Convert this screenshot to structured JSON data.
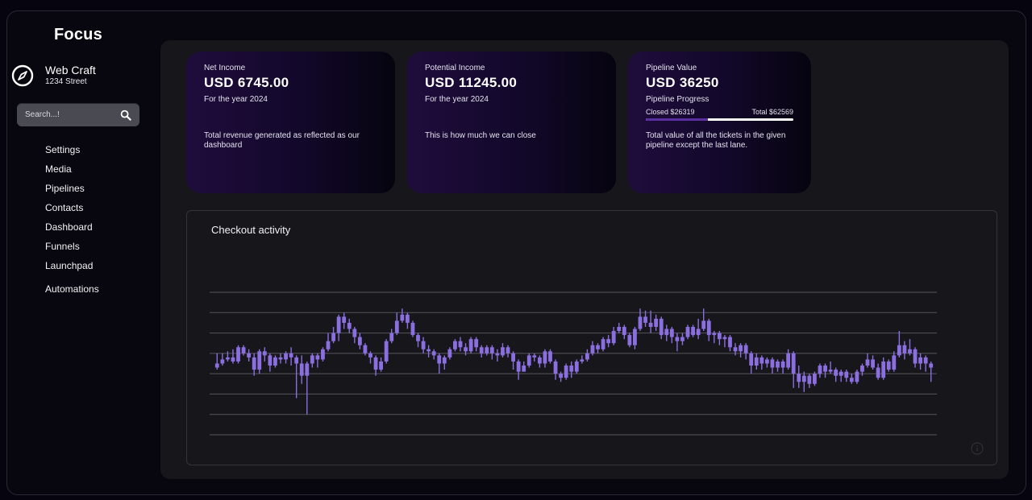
{
  "app": {
    "brand": "Focus"
  },
  "account": {
    "name": "Web Craft",
    "address": "1234 Street"
  },
  "search": {
    "placeholder": "Search...!"
  },
  "nav": {
    "items": [
      "Settings",
      "Media",
      "Pipelines",
      "Contacts",
      "Dashboard",
      "Funnels",
      "Launchpad",
      "Automations"
    ]
  },
  "cards": {
    "net_income": {
      "label": "Net Income",
      "value": "USD 6745.00",
      "sub": "For the year 2024",
      "desc": "Total revenue generated as reflected as our dashboard"
    },
    "potential_income": {
      "label": "Potential Income",
      "value": "USD 11245.00",
      "sub": "For the year 2024",
      "desc": "This is how much we can close"
    },
    "pipeline_value": {
      "label": "Pipeline Value",
      "value": "USD 36250",
      "sub": "Pipeline Progress",
      "closed_label": "Closed $26319",
      "total_label": "Total $62569",
      "progress": 0.42,
      "desc": "Total value of all the tickets in the given pipeline except the last lane."
    }
  },
  "colors": {
    "accent": "#8b6ee0",
    "progress_fill": "#5a2fa0",
    "card_start": "#1f0c3c",
    "card_end": "#06040f"
  },
  "icons": {
    "account": "compass-icon",
    "search": "search-icon",
    "chart_info": "info-icon"
  },
  "chart_data": {
    "type": "candlestick",
    "title": "Checkout activity",
    "ylim": [
      0,
      7
    ],
    "grid": true,
    "series": [
      {
        "values": [
          [
            3.5,
            3.3,
            4.0,
            3.2
          ],
          [
            3.5,
            3.7,
            4.0,
            3.4
          ],
          [
            3.7,
            3.8,
            4.1,
            3.6
          ],
          [
            3.8,
            3.6,
            4.2,
            3.5
          ],
          [
            3.6,
            4.3,
            4.4,
            3.5
          ],
          [
            4.3,
            4.0,
            4.4,
            3.9
          ],
          [
            4.0,
            3.8,
            4.2,
            3.6
          ],
          [
            3.8,
            3.2,
            4.0,
            2.9
          ],
          [
            3.2,
            4.1,
            4.2,
            3.0
          ],
          [
            4.1,
            3.9,
            4.3,
            3.6
          ],
          [
            3.9,
            3.4,
            4.0,
            3.1
          ],
          [
            3.4,
            3.8,
            3.9,
            3.3
          ],
          [
            3.8,
            3.7,
            4.0,
            3.5
          ],
          [
            3.7,
            4.0,
            4.1,
            3.5
          ],
          [
            4.0,
            3.8,
            4.3,
            3.4
          ],
          [
            3.8,
            3.5,
            3.9,
            1.8
          ],
          [
            3.5,
            2.9,
            3.9,
            2.5
          ],
          [
            2.9,
            3.5,
            3.6,
            1.0
          ],
          [
            3.5,
            3.9,
            4.0,
            3.3
          ],
          [
            3.9,
            3.7,
            4.0,
            3.3
          ],
          [
            3.7,
            4.2,
            4.3,
            3.6
          ],
          [
            4.2,
            4.6,
            5.0,
            4.1
          ],
          [
            4.6,
            5.0,
            5.3,
            4.5
          ],
          [
            5.0,
            5.8,
            5.9,
            4.6
          ],
          [
            5.8,
            5.5,
            6.0,
            5.2
          ],
          [
            5.5,
            5.2,
            5.7,
            5.0
          ],
          [
            5.2,
            4.8,
            5.3,
            4.5
          ],
          [
            4.8,
            4.4,
            5.0,
            4.2
          ],
          [
            4.4,
            4.0,
            4.5,
            3.9
          ],
          [
            4.0,
            3.8,
            4.1,
            3.5
          ],
          [
            3.8,
            3.2,
            3.9,
            2.9
          ],
          [
            3.2,
            3.6,
            3.8,
            3.1
          ],
          [
            3.6,
            4.6,
            4.7,
            3.5
          ],
          [
            4.6,
            5.0,
            5.2,
            4.5
          ],
          [
            5.0,
            5.6,
            6.0,
            4.9
          ],
          [
            5.6,
            5.9,
            6.2,
            5.5
          ],
          [
            5.9,
            5.5,
            6.0,
            5.2
          ],
          [
            5.5,
            4.9,
            5.6,
            4.8
          ],
          [
            4.9,
            4.6,
            5.0,
            4.3
          ],
          [
            4.6,
            4.2,
            4.8,
            4.0
          ],
          [
            4.2,
            4.1,
            4.4,
            3.8
          ],
          [
            4.1,
            3.9,
            4.2,
            3.7
          ],
          [
            3.9,
            3.5,
            4.0,
            3.0
          ],
          [
            3.5,
            3.8,
            3.9,
            3.2
          ],
          [
            3.8,
            4.2,
            4.3,
            3.7
          ],
          [
            4.2,
            4.6,
            4.7,
            4.1
          ],
          [
            4.6,
            4.3,
            4.8,
            4.1
          ],
          [
            4.3,
            4.1,
            4.5,
            3.9
          ],
          [
            4.1,
            4.7,
            4.8,
            4.0
          ],
          [
            4.7,
            4.3,
            4.8,
            4.1
          ],
          [
            4.3,
            4.0,
            4.4,
            3.8
          ],
          [
            4.0,
            4.3,
            4.4,
            3.9
          ],
          [
            4.3,
            4.0,
            4.4,
            3.7
          ],
          [
            4.0,
            3.9,
            4.2,
            3.6
          ],
          [
            3.9,
            4.3,
            4.5,
            3.8
          ],
          [
            4.3,
            4.0,
            4.4,
            3.8
          ],
          [
            4.0,
            3.6,
            4.1,
            3.2
          ],
          [
            3.6,
            3.1,
            3.7,
            2.7
          ],
          [
            3.1,
            3.4,
            3.6,
            3.1
          ],
          [
            3.4,
            3.9,
            4.0,
            3.3
          ],
          [
            3.9,
            3.8,
            4.0,
            3.6
          ],
          [
            3.8,
            3.5,
            3.9,
            3.3
          ],
          [
            3.5,
            4.1,
            4.2,
            3.3
          ],
          [
            4.1,
            3.6,
            4.2,
            3.5
          ],
          [
            3.6,
            3.0,
            3.7,
            2.7
          ],
          [
            3.0,
            2.8,
            3.1,
            2.6
          ],
          [
            2.8,
            3.4,
            3.5,
            2.7
          ],
          [
            3.4,
            3.1,
            3.6,
            2.8
          ],
          [
            3.1,
            3.6,
            3.7,
            3.0
          ],
          [
            3.6,
            3.7,
            3.9,
            3.5
          ],
          [
            3.7,
            4.0,
            4.2,
            3.6
          ],
          [
            4.0,
            4.4,
            4.6,
            3.9
          ],
          [
            4.4,
            4.2,
            4.5,
            4.0
          ],
          [
            4.2,
            4.7,
            4.8,
            4.1
          ],
          [
            4.7,
            4.5,
            4.9,
            4.3
          ],
          [
            4.5,
            5.1,
            5.3,
            4.4
          ],
          [
            5.1,
            5.3,
            5.5,
            5.0
          ],
          [
            5.3,
            4.9,
            5.4,
            4.7
          ],
          [
            4.9,
            4.4,
            5.0,
            4.3
          ],
          [
            4.4,
            5.2,
            5.3,
            4.2
          ],
          [
            5.2,
            5.8,
            6.2,
            5.1
          ],
          [
            5.8,
            5.5,
            6.1,
            5.3
          ],
          [
            5.5,
            5.3,
            6.1,
            5.0
          ],
          [
            5.3,
            5.7,
            5.9,
            5.1
          ],
          [
            5.7,
            4.9,
            5.8,
            4.7
          ],
          [
            4.9,
            5.2,
            5.4,
            4.6
          ],
          [
            5.2,
            4.8,
            5.3,
            4.5
          ],
          [
            4.8,
            4.6,
            5.0,
            4.1
          ],
          [
            4.6,
            4.8,
            5.0,
            4.4
          ],
          [
            4.8,
            5.3,
            5.4,
            4.7
          ],
          [
            5.3,
            4.9,
            5.4,
            4.8
          ],
          [
            4.9,
            5.2,
            5.7,
            4.7
          ],
          [
            5.2,
            5.6,
            6.2,
            5.1
          ],
          [
            5.6,
            4.9,
            5.7,
            4.6
          ],
          [
            4.9,
            5.0,
            5.1,
            4.5
          ],
          [
            5.0,
            4.7,
            5.1,
            4.4
          ],
          [
            4.7,
            4.8,
            4.9,
            4.3
          ],
          [
            4.8,
            4.3,
            4.9,
            4.1
          ],
          [
            4.3,
            4.1,
            4.5,
            3.9
          ],
          [
            4.1,
            4.4,
            4.5,
            3.8
          ],
          [
            4.4,
            4.0,
            4.5,
            3.7
          ],
          [
            4.0,
            3.4,
            4.1,
            3.0
          ],
          [
            3.4,
            3.8,
            4.0,
            3.2
          ],
          [
            3.8,
            3.5,
            3.9,
            3.2
          ],
          [
            3.5,
            3.7,
            3.8,
            3.3
          ],
          [
            3.7,
            3.3,
            3.8,
            3.0
          ],
          [
            3.3,
            3.6,
            3.7,
            3.1
          ],
          [
            3.6,
            3.3,
            3.7,
            3.0
          ],
          [
            3.3,
            4.0,
            4.2,
            3.2
          ],
          [
            4.0,
            3.0,
            4.1,
            2.3
          ],
          [
            3.0,
            2.6,
            3.4,
            2.3
          ],
          [
            2.6,
            2.9,
            3.1,
            2.1
          ],
          [
            2.9,
            2.5,
            3.0,
            2.3
          ],
          [
            2.5,
            3.0,
            3.1,
            2.4
          ],
          [
            3.0,
            3.4,
            3.5,
            2.8
          ],
          [
            3.4,
            3.1,
            3.5,
            2.8
          ],
          [
            3.1,
            3.2,
            3.6,
            3.0
          ],
          [
            3.2,
            2.9,
            3.3,
            2.6
          ],
          [
            2.9,
            3.1,
            3.2,
            2.6
          ],
          [
            3.1,
            2.8,
            3.2,
            2.6
          ],
          [
            2.8,
            2.6,
            3.0,
            2.5
          ],
          [
            2.6,
            3.1,
            3.2,
            2.5
          ],
          [
            3.1,
            3.4,
            3.5,
            2.9
          ],
          [
            3.4,
            3.7,
            4.0,
            3.3
          ],
          [
            3.7,
            3.3,
            3.9,
            3.2
          ],
          [
            3.3,
            2.8,
            3.5,
            2.7
          ],
          [
            2.8,
            3.6,
            3.8,
            2.7
          ],
          [
            3.6,
            3.2,
            3.7,
            3.1
          ],
          [
            3.2,
            3.9,
            4.1,
            3.1
          ],
          [
            3.9,
            4.4,
            5.1,
            3.8
          ],
          [
            4.4,
            4.0,
            4.6,
            3.7
          ],
          [
            4.0,
            4.2,
            4.7,
            3.9
          ],
          [
            4.2,
            3.5,
            4.3,
            3.3
          ],
          [
            3.5,
            3.8,
            4.0,
            3.2
          ],
          [
            3.8,
            3.5,
            3.9,
            3.1
          ],
          [
            3.5,
            3.3,
            3.6,
            2.6
          ]
        ]
      }
    ]
  }
}
